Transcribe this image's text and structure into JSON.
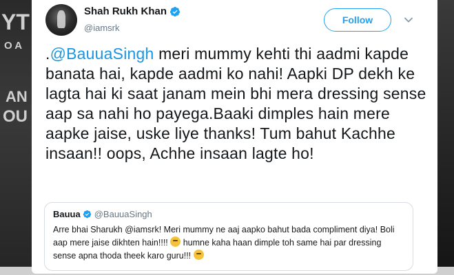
{
  "background": {
    "left_text": [
      "YT",
      "O A",
      "AN",
      "OU"
    ]
  },
  "tweet": {
    "author": {
      "display_name": "Shah Rukh Khan",
      "handle": "@iamsrk",
      "verified": true
    },
    "follow_label": "Follow",
    "text_prefix": ".",
    "mention": "@BauuaSingh",
    "text_body": " meri mummy kehti thi aadmi kapde banata hai, kapde aadmi ko nahi! Aapki DP dekh ke lagta hai ki saat janam mein bhi mera dressing sense aap sa nahi ho payega.Baaki dimples hain mere aapke jaise, uske liye thanks! Tum bahut Kachhe insaan!! oops, Achhe insaan lagte ho!",
    "quoted": {
      "display_name": "Bauua",
      "handle": "@BauuaSingh",
      "verified": true,
      "text_part1": "Arre bhai Sharukh @iamsrk! Meri mummy ne aaj aapko bahut bada compliment diya! Boli aap mere jaise dikhten hain!!!! ",
      "text_part2": " humne kaha haan dimple toh same hai par dressing sense apna thoda theek karo guru!!! ",
      "emoji_1": "thinking-face-emoji",
      "emoji_2": "rolling-eyes-emoji"
    }
  },
  "colors": {
    "brand_blue": "#1da1f2",
    "mention_blue": "#1b95e0",
    "text_dark": "#14171a",
    "text_muted": "#657786",
    "border": "#d6dce2"
  }
}
